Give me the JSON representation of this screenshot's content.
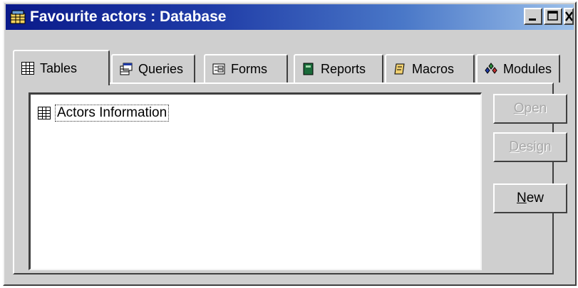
{
  "window": {
    "title": "Favourite actors : Database",
    "icon": "database-window-icon",
    "controls": [
      "minimize-icon",
      "maximize-icon",
      "close-icon"
    ]
  },
  "tabs": [
    {
      "label": "Tables",
      "icon": "table-icon",
      "active": true
    },
    {
      "label": "Queries",
      "icon": "query-icon",
      "active": false
    },
    {
      "label": "Forms",
      "icon": "form-icon",
      "active": false
    },
    {
      "label": "Reports",
      "icon": "report-icon",
      "active": false
    },
    {
      "label": "Macros",
      "icon": "macro-icon",
      "active": false
    },
    {
      "label": "Modules",
      "icon": "module-icon",
      "active": false
    }
  ],
  "list": {
    "items": [
      {
        "label": "Actors Information",
        "icon": "table-icon",
        "selected": true
      }
    ]
  },
  "buttons": {
    "open": {
      "label": "Open",
      "mnemonic": "O",
      "rest": "pen",
      "enabled": false
    },
    "design": {
      "label": "Design",
      "mnemonic": "D",
      "rest": "esign",
      "enabled": false
    },
    "new": {
      "label": "New",
      "mnemonic": "N",
      "rest": "ew",
      "enabled": true
    }
  },
  "colors": {
    "title_start": "#0a1a8a",
    "title_end": "#9cc0ea",
    "face": "#cfcfcf"
  }
}
